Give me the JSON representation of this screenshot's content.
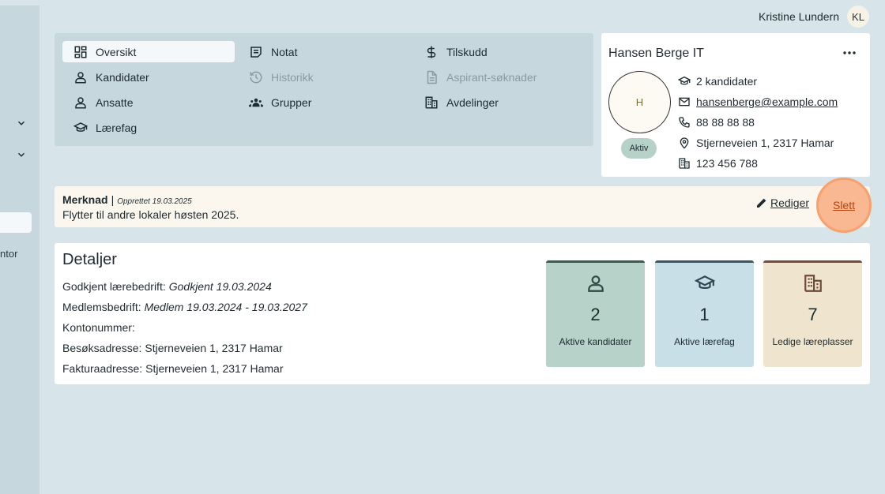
{
  "user": {
    "name": "Kristine Lundern",
    "initials": "KL"
  },
  "sidebar": {
    "partial_label": "ntor"
  },
  "nav": {
    "items": [
      {
        "label": "Oversikt",
        "icon": "dashboard-icon",
        "active": true
      },
      {
        "label": "Notat",
        "icon": "note-icon"
      },
      {
        "label": "Tilskudd",
        "icon": "dollar-icon"
      },
      {
        "label": "Kandidater",
        "icon": "person-icon"
      },
      {
        "label": "Historikk",
        "icon": "history-icon",
        "disabled": true
      },
      {
        "label": "Aspirant-søknader",
        "icon": "document-icon",
        "disabled": true
      },
      {
        "label": "Ansatte",
        "icon": "person-icon"
      },
      {
        "label": "Grupper",
        "icon": "groups-icon"
      },
      {
        "label": "Avdelinger",
        "icon": "building-icon"
      },
      {
        "label": "Lærefag",
        "icon": "school-icon"
      }
    ]
  },
  "org": {
    "name": "Hansen Berge IT",
    "logo_initial": "H",
    "status": "Aktiv",
    "candidates": "2 kandidater",
    "email": "hansenberge@example.com",
    "phone": "88 88 88 88",
    "address": "Stjerneveien 1, 2317 Hamar",
    "org_number": "123 456 788"
  },
  "remark": {
    "label": "Merknad",
    "separator": "|",
    "created": "Opprettet 19.03.2025",
    "text": "Flytter til andre lokaler høsten 2025.",
    "edit_label": "Rediger",
    "delete_label": "Slett"
  },
  "details": {
    "title": "Detaljer",
    "rows": [
      {
        "key": "Godkjent lærebedrift:",
        "value": "Godkjent 19.03.2024",
        "italic": true
      },
      {
        "key": "Medlemsbedrift:",
        "value": "Medlem 19.03.2024 - 19.03.2027",
        "italic": true
      },
      {
        "key": "Kontonummer:",
        "value": ""
      },
      {
        "key": "Besøksadresse:",
        "value": "Stjerneveien 1, 2317 Hamar"
      },
      {
        "key": "Fakturaadresse:",
        "value": "Stjerneveien 1, 2317 Hamar"
      }
    ],
    "stats": [
      {
        "value": "2",
        "label": "Aktive kandidater",
        "icon": "person-icon",
        "bg": "#b6d2c9",
        "border": "#3e5a52"
      },
      {
        "value": "1",
        "label": "Aktive lærefag",
        "icon": "school-icon",
        "bg": "#c8dfe8",
        "border": "#3e5560"
      },
      {
        "value": "7",
        "label": "Ledige læreplasser",
        "icon": "building-icon",
        "bg": "#efe5cf",
        "border": "#6b5040"
      }
    ]
  },
  "colors": {
    "background": "#d7e4e9",
    "panel": "#c6d7dd",
    "accent_delete": "#f7a16f",
    "status_active": "#b5d1c8"
  }
}
